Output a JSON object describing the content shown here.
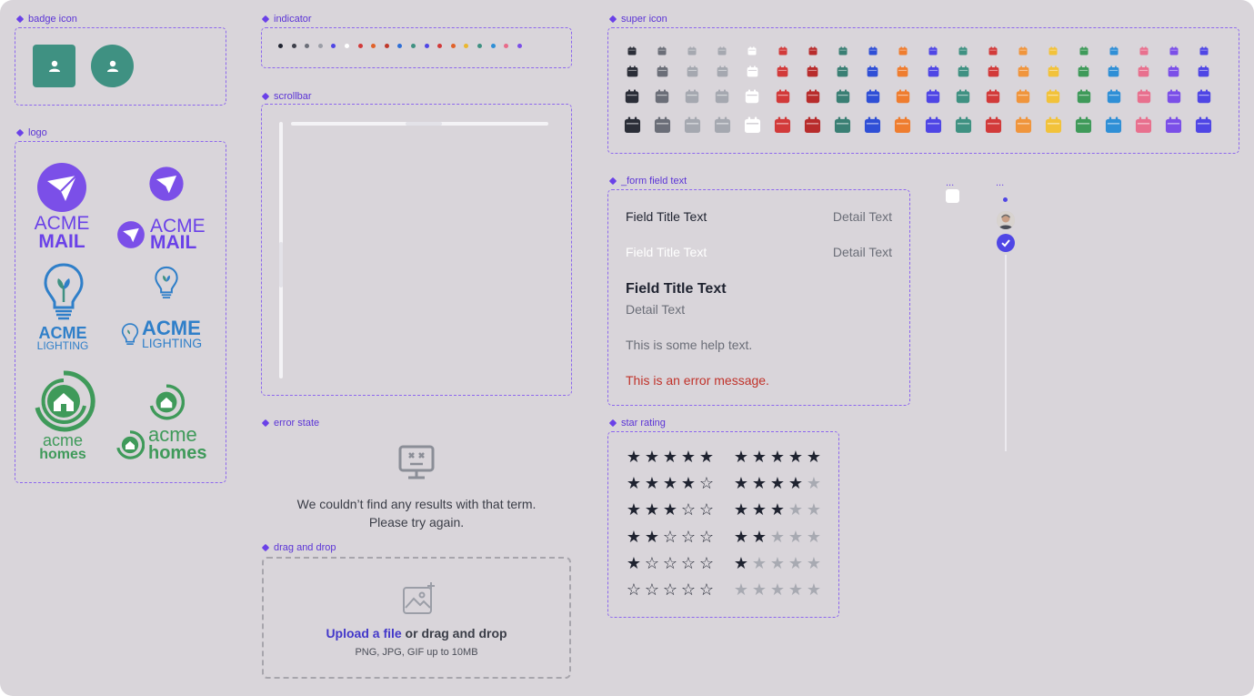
{
  "sections": {
    "badge_icon": "badge icon",
    "logo": "logo",
    "indicator": "indicator",
    "scrollbar": "scrollbar",
    "error_state": "error state",
    "drag_and_drop": "drag and drop",
    "super_icon": "super icon",
    "form_field_text": "_form field text",
    "star_rating": "star rating",
    "ellipsis_a": "...",
    "ellipsis_b": "..."
  },
  "logos": {
    "mail_line1": "ACME",
    "mail_line2": "MAIL",
    "lighting_line1": "ACME",
    "lighting_line2": "LIGHTING",
    "homes_line1": "acme",
    "homes_line2": "homes"
  },
  "indicator_colors": [
    "#1f2330",
    "#3d3f4a",
    "#6b6e78",
    "#9b9ea7",
    "#4f46e5",
    "#ffffff",
    "#d23a3a",
    "#e0622a",
    "#c0392b",
    "#2f6fd6",
    "#3f9182",
    "#4f46e5",
    "#d23a3a",
    "#e0622a",
    "#eab72f",
    "#3f9182",
    "#2f8fd6",
    "#e86b8a",
    "#7b4fe8"
  ],
  "super_icon_colors": [
    "#2b2e38",
    "#6b6e78",
    "#a5a8b0",
    "#a5a8b0",
    "#ffffff",
    "#d23a3a",
    "#b82c2c",
    "#3a7f74",
    "#2f4fd6",
    "#ef7d2f",
    "#4f46e5",
    "#3f9182",
    "#d23a3a",
    "#f0953c",
    "#f2c23a",
    "#3f9a5a",
    "#2f8fd6",
    "#e8708e",
    "#7b4fe8",
    "#4f46e5"
  ],
  "form_field": {
    "row1_title": "Field Title Text",
    "row1_detail": "Detail Text",
    "row2_title": "Field Title Text",
    "row2_detail": "Detail Text",
    "row3_title": "Field Title Text",
    "row3_detail": "Detail Text",
    "help_text": "This is some help text.",
    "error_text": "This is an error message."
  },
  "error_state": {
    "line1": "We couldn’t find any results with that term.",
    "line2": "Please try again."
  },
  "drag_and_drop": {
    "link": "Upload a file",
    "rest": " or drag and drop",
    "hint": "PNG, JPG, GIF up to 10MB"
  },
  "star_ratings": [
    {
      "filled": 5,
      "outline": 5
    },
    {
      "filled": 4,
      "outline": 5
    },
    {
      "filled": 3,
      "outline": 5
    },
    {
      "filled": 2,
      "outline": 5
    },
    {
      "filled": 1,
      "outline": 5
    },
    {
      "filled": 0,
      "outline": 5
    }
  ],
  "colors": {
    "accent": "#6a41e8",
    "teal": "#3f9182",
    "error": "#c0322a",
    "link": "#4338ca"
  }
}
